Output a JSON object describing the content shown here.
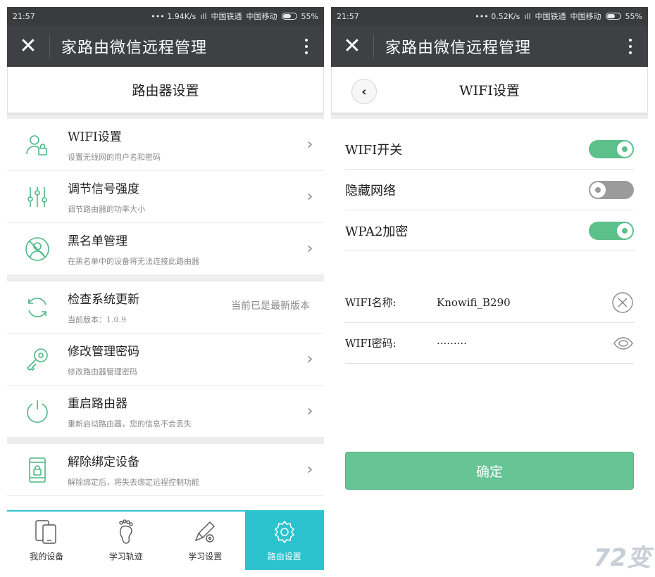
{
  "left": {
    "statusbar": {
      "time": "21:57",
      "speed": "1.94K/s",
      "carrier1": "中国铁通",
      "carrier2": "中国移动",
      "battery": "55%"
    },
    "appbar": {
      "close": "✕",
      "title": "家路由微信远程管理"
    },
    "subheader": "路由器设置",
    "items": [
      {
        "title": "WIFI设置",
        "sub": "设置无线网的用户名和密码",
        "icon": "user-lock-icon"
      },
      {
        "title": "调节信号强度",
        "sub": "调节路由器的功率大小",
        "icon": "sliders-icon"
      },
      {
        "title": "黑名单管理",
        "sub": "在黑名单中的设备将无法连接此路由器",
        "icon": "blacklist-user-icon"
      },
      {
        "title": "检查系统更新",
        "sub": "当前版本：1.0.9",
        "status": "当前已是最新版本",
        "icon": "refresh-icon"
      },
      {
        "title": "修改管理密码",
        "sub": "修改路由器管理密码",
        "icon": "key-icon"
      },
      {
        "title": "重启路由器",
        "sub": "重新启动路由器，您的信息不会丢失",
        "icon": "power-icon"
      },
      {
        "title": "解除绑定设备",
        "sub": "解除绑定后，将失去绑定远程控制功能",
        "icon": "phone-lock-icon"
      }
    ],
    "tabs": [
      {
        "label": "我的设备",
        "icon": "devices-icon"
      },
      {
        "label": "学习轨迹",
        "icon": "footprint-icon"
      },
      {
        "label": "学习设置",
        "icon": "pencil-gear-icon"
      },
      {
        "label": "路由设置",
        "icon": "gear-icon"
      }
    ]
  },
  "right": {
    "statusbar": {
      "time": "21:57",
      "speed": "0.52K/s",
      "carrier1": "中国铁通",
      "carrier2": "中国移动",
      "battery": "55%"
    },
    "appbar": {
      "close": "✕",
      "title": "家路由微信远程管理"
    },
    "subheader": "WIFI设置",
    "toggles": [
      {
        "label": "WIFI开关",
        "on": true
      },
      {
        "label": "隐藏网络",
        "on": false
      },
      {
        "label": "WPA2加密",
        "on": true
      }
    ],
    "fields": {
      "name_label": "WIFI名称:",
      "name_value": "Knowifi_B290",
      "pwd_label": "WIFI密码:",
      "pwd_value": "·········"
    },
    "confirm": "确定"
  },
  "colors": {
    "accent_green": "#5cc08b",
    "tab_active": "#2cc3cf",
    "appbar": "#3f4043"
  },
  "watermark": "72变"
}
